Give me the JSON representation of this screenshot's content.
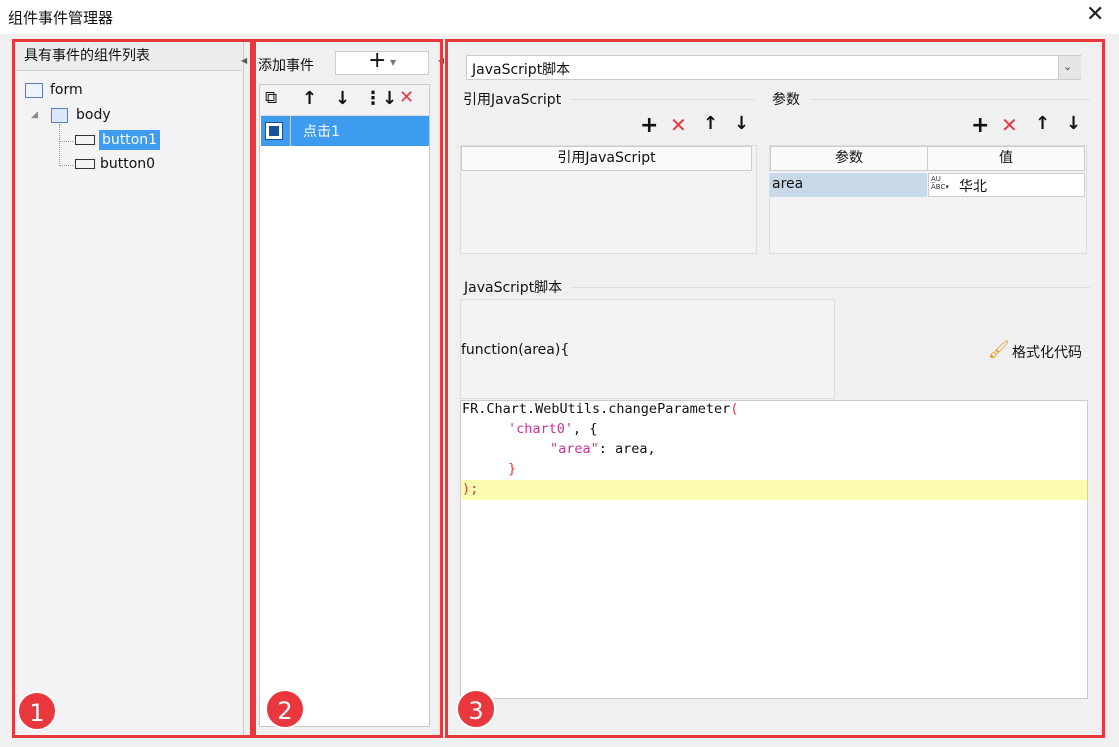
{
  "window": {
    "title": "组件事件管理器"
  },
  "left": {
    "header": "具有事件的组件列表",
    "tree": [
      {
        "label": "form"
      },
      {
        "label": "body"
      },
      {
        "label": "button1"
      },
      {
        "label": "button0"
      }
    ]
  },
  "middle": {
    "add_event_label": "添加事件",
    "add_symbol": "+",
    "events": [
      {
        "label": "点击1"
      }
    ]
  },
  "right": {
    "script_type": "JavaScript脚本",
    "ref_js": {
      "section_label": "引用JavaScript",
      "column": "引用JavaScript"
    },
    "params": {
      "section_label": "参数",
      "col_param": "参数",
      "col_value": "值",
      "rows": [
        {
          "name": "area",
          "value": "华北"
        }
      ]
    },
    "script_section_label": "JavaScript脚本",
    "function_signature": "function(area){",
    "format_code_label": "格式化代码",
    "code": {
      "l1": "FR.Chart.WebUtils.changeParameter",
      "l1b": "(",
      "l2": "'chart0'",
      "l2b": ", {",
      "l3": "\"area\"",
      "l3b": ": area,",
      "l4": "}",
      "l5": ");"
    }
  },
  "badges": [
    "1",
    "2",
    "3"
  ],
  "colors": {
    "accent_red": "#e8383d",
    "selection_blue": "#3d9bf0",
    "code_string": "#c8339a"
  }
}
